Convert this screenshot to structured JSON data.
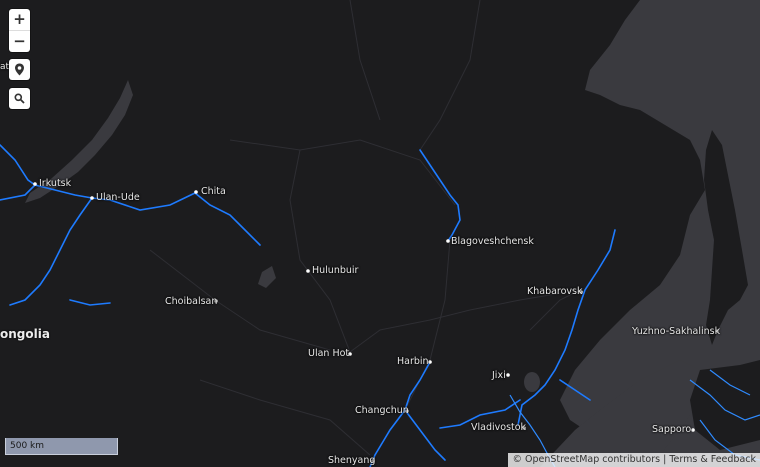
{
  "controls": {
    "zoom_in": "+",
    "zoom_out": "−"
  },
  "places": [
    {
      "name": "Irkutsk"
    },
    {
      "name": "Ulan-Ude"
    },
    {
      "name": "Chita"
    },
    {
      "name": "Blagoveshchensk"
    },
    {
      "name": "Hulunbuir"
    },
    {
      "name": "Choibalsan"
    },
    {
      "name": "Khabarovsk"
    },
    {
      "name": "Yuzhno-Sakhalinsk"
    },
    {
      "name": "Ulan Hot"
    },
    {
      "name": "Harbin"
    },
    {
      "name": "Jixi"
    },
    {
      "name": "Changchun"
    },
    {
      "name": "Vladivostok"
    },
    {
      "name": "Sapporo"
    },
    {
      "name": "Shenyang"
    }
  ],
  "country_label": "ongolia",
  "partial_label_left": "at",
  "scale_label": "500 km",
  "attribution": {
    "copyright": "© OpenStreetMap contributors",
    "separator": "|",
    "terms": "Terms & Feedback"
  },
  "colors": {
    "land": "#1c1c1e",
    "water": "#3a3a3f",
    "route": "#1e7bff"
  }
}
